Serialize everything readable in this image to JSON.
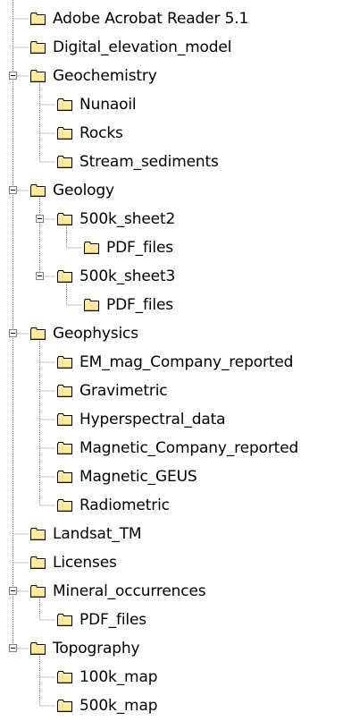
{
  "tree": {
    "items": [
      {
        "label": "Adobe Acrobat Reader 5.1",
        "depth": 0,
        "expanded": false,
        "has_children": false
      },
      {
        "label": "Digital_elevation_model",
        "depth": 0,
        "expanded": false,
        "has_children": false
      },
      {
        "label": "Geochemistry",
        "depth": 0,
        "expanded": true,
        "has_children": true
      },
      {
        "label": "Nunaoil",
        "depth": 1,
        "expanded": false,
        "has_children": false
      },
      {
        "label": "Rocks",
        "depth": 1,
        "expanded": false,
        "has_children": false
      },
      {
        "label": "Stream_sediments",
        "depth": 1,
        "expanded": false,
        "has_children": false
      },
      {
        "label": "Geology",
        "depth": 0,
        "expanded": true,
        "has_children": true
      },
      {
        "label": "500k_sheet2",
        "depth": 1,
        "expanded": true,
        "has_children": true
      },
      {
        "label": "PDF_files",
        "depth": 2,
        "expanded": false,
        "has_children": false
      },
      {
        "label": "500k_sheet3",
        "depth": 1,
        "expanded": true,
        "has_children": true
      },
      {
        "label": "PDF_files",
        "depth": 2,
        "expanded": false,
        "has_children": false
      },
      {
        "label": "Geophysics",
        "depth": 0,
        "expanded": true,
        "has_children": true
      },
      {
        "label": "EM_mag_Company_reported",
        "depth": 1,
        "expanded": false,
        "has_children": false
      },
      {
        "label": "Gravimetric",
        "depth": 1,
        "expanded": false,
        "has_children": false
      },
      {
        "label": "Hyperspectral_data",
        "depth": 1,
        "expanded": false,
        "has_children": false
      },
      {
        "label": "Magnetic_Company_reported",
        "depth": 1,
        "expanded": false,
        "has_children": false
      },
      {
        "label": "Magnetic_GEUS",
        "depth": 1,
        "expanded": false,
        "has_children": false
      },
      {
        "label": "Radiometric",
        "depth": 1,
        "expanded": false,
        "has_children": false
      },
      {
        "label": "Landsat_TM",
        "depth": 0,
        "expanded": false,
        "has_children": false
      },
      {
        "label": "Licenses",
        "depth": 0,
        "expanded": false,
        "has_children": false
      },
      {
        "label": "Mineral_occurrences",
        "depth": 0,
        "expanded": true,
        "has_children": true
      },
      {
        "label": "PDF_files",
        "depth": 1,
        "expanded": false,
        "has_children": false
      },
      {
        "label": "Topography",
        "depth": 0,
        "expanded": true,
        "has_children": true
      },
      {
        "label": "100k_map",
        "depth": 1,
        "expanded": false,
        "has_children": false
      },
      {
        "label": "500k_map",
        "depth": 1,
        "expanded": false,
        "has_children": false
      }
    ]
  },
  "colors": {
    "folder_fill": "#FFE98F",
    "folder_fill_light": "#FFF4B8",
    "folder_outline": "#000000",
    "guide_line": "#808080",
    "text": "#000000",
    "background": "#FFFFFF"
  },
  "icons": {
    "folder": "folder-closed-icon",
    "expander": "collapse-minus-icon"
  }
}
